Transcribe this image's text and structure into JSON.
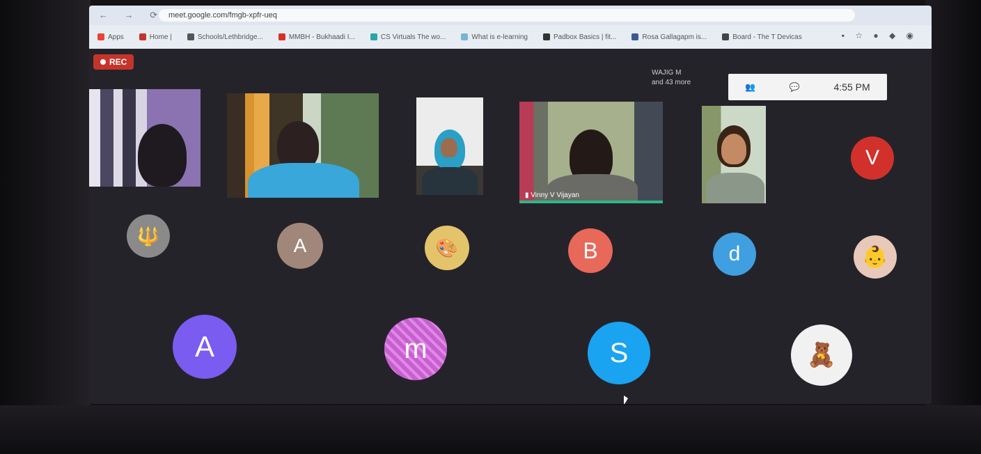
{
  "browser": {
    "url": "meet.google.com/fmgb-xpfr-ueq",
    "bookmarks": [
      {
        "label": "Apps",
        "color": "#e94235"
      },
      {
        "label": "Home |",
        "color": "#c5342b"
      },
      {
        "label": "Schools/Lethbridge...",
        "color": "#555555"
      },
      {
        "label": "MMBH - Bukhaadi I...",
        "color": "#d93025"
      },
      {
        "label": "CS Virtuals The wo...",
        "color": "#2aa6a6"
      },
      {
        "label": "What is e-learning",
        "color": "#7ab4d4"
      },
      {
        "label": "Padbox Basics | fit...",
        "color": "#333333"
      },
      {
        "label": "Rosa Gallagapm is...",
        "color": "#3b5998"
      },
      {
        "label": "Board - The T Devicas",
        "color": "#444444"
      }
    ]
  },
  "meeting": {
    "rec_label": "REC",
    "overflow_line1": "WAJIG M",
    "overflow_line2": "and 43 more",
    "time": "4:55 PM",
    "speaker_name": "Vinny V Vijayan",
    "avatars": [
      {
        "initial": "",
        "color": "#8a8a8a",
        "icon": "trident-picture"
      },
      {
        "initial": "A",
        "color": "#a1877a"
      },
      {
        "initial": "",
        "color": "#e3c46b",
        "icon": "art-picture"
      },
      {
        "initial": "B",
        "color": "#e8685a"
      },
      {
        "initial": "d",
        "color": "#3f9fe0"
      },
      {
        "initial": "",
        "color": "#e8c9b9",
        "icon": "baby-picture"
      },
      {
        "initial": "V",
        "color": "#d2312b"
      },
      {
        "initial": "A",
        "color": "#7a5cf0"
      },
      {
        "initial": "m",
        "color": "#c85fd0"
      },
      {
        "initial": "S",
        "color": "#1aa3f0"
      },
      {
        "initial": "",
        "color": "#f1f1f1",
        "icon": "figure-picture"
      }
    ]
  }
}
